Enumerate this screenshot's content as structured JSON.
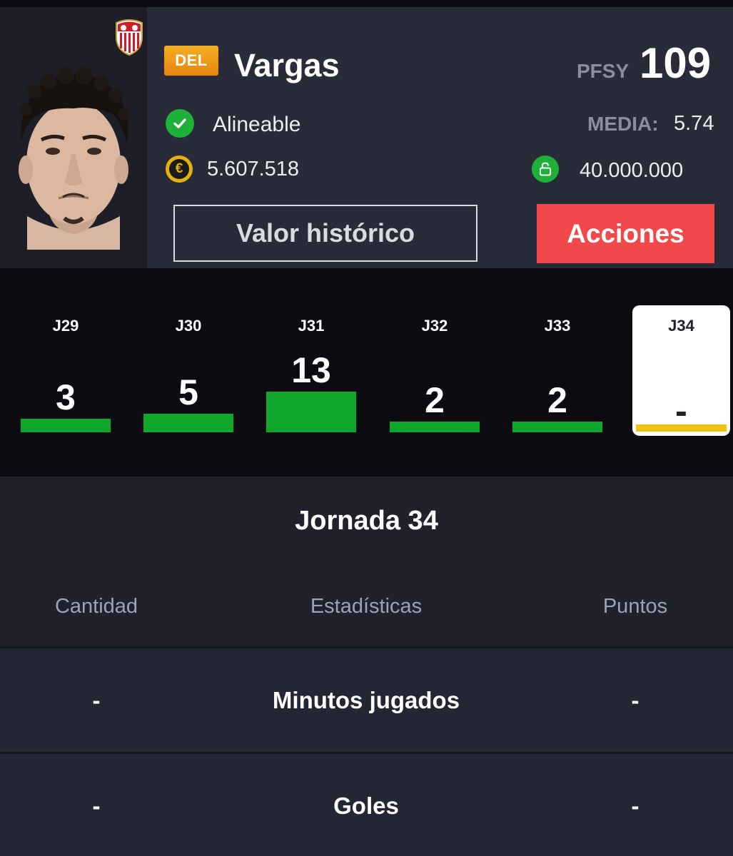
{
  "player": {
    "position": "DEL",
    "name": "Vargas",
    "pfsy_label": "PFSY",
    "pfsy_value": "109",
    "status": "Alineable",
    "media_label": "MEDIA:",
    "media_value": "5.74",
    "market_value": "5.607.518",
    "clause_value": "40.000.000",
    "team_crest": "sevilla-crest",
    "status_icon": "check-icon",
    "value_icon": "euro-coin-icon",
    "clause_icon": "lock-icon"
  },
  "buttons": {
    "history": "Valor histórico",
    "actions": "Acciones"
  },
  "colors": {
    "position_badge": "#f0a21d",
    "actions_button": "#f0484b",
    "points_bar": "#0fa82b",
    "current_round_bar": "#f1c40f",
    "status_green": "#1fb03a",
    "coin_gold": "#e2b10e"
  },
  "rounds": [
    {
      "label": "J29",
      "points": "3",
      "value": 3
    },
    {
      "label": "J30",
      "points": "5",
      "value": 5
    },
    {
      "label": "J31",
      "points": "13",
      "value": 13
    },
    {
      "label": "J32",
      "points": "2",
      "value": 2
    },
    {
      "label": "J33",
      "points": "2",
      "value": 2
    },
    {
      "label": "J34",
      "points": "-",
      "value": null,
      "current": true
    }
  ],
  "stats": {
    "title": "Jornada 34",
    "headers": [
      "Cantidad",
      "Estadísticas",
      "Puntos"
    ],
    "rows": [
      {
        "quantity": "-",
        "stat": "Minutos jugados",
        "points": "-"
      },
      {
        "quantity": "-",
        "stat": "Goles",
        "points": "-"
      }
    ]
  }
}
